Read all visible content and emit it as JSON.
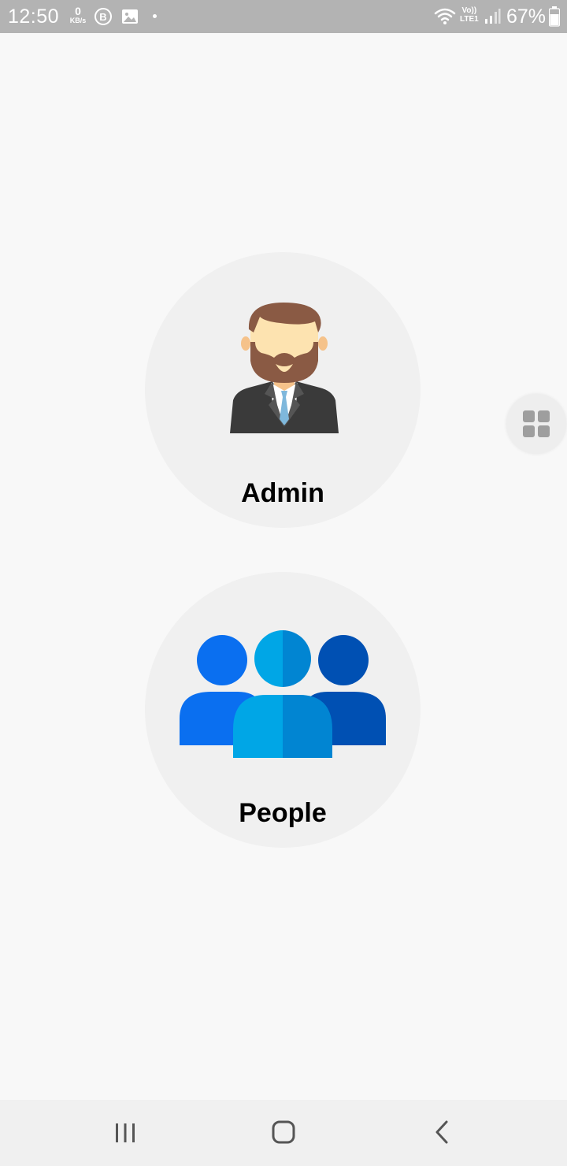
{
  "status_bar": {
    "time": "12:50",
    "net_speed_value": "0",
    "net_speed_unit": "KB/s",
    "lte_top": "Vo))",
    "lte_bottom": "LTE1",
    "battery": "67%",
    "icons": [
      "b-circle-icon",
      "image-icon",
      "wifi-icon",
      "signal-icon",
      "battery-icon"
    ]
  },
  "roles": {
    "admin": {
      "label": "Admin",
      "icon": "businessman-icon"
    },
    "people": {
      "label": "People",
      "icon": "group-people-icon"
    }
  },
  "floating_button": {
    "icon": "grid-menu-icon"
  },
  "nav_bar": {
    "buttons": [
      "recent-apps-icon",
      "home-icon",
      "back-icon"
    ]
  },
  "colors": {
    "status_bar_bg": "#b3b3b3",
    "background": "#f8f8f8",
    "card_bg": "#f0f0f0",
    "people_left": "#0a6ff0",
    "people_center": "#00a6e6",
    "people_center_dark": "#0185d2",
    "people_right": "#0050b3"
  }
}
